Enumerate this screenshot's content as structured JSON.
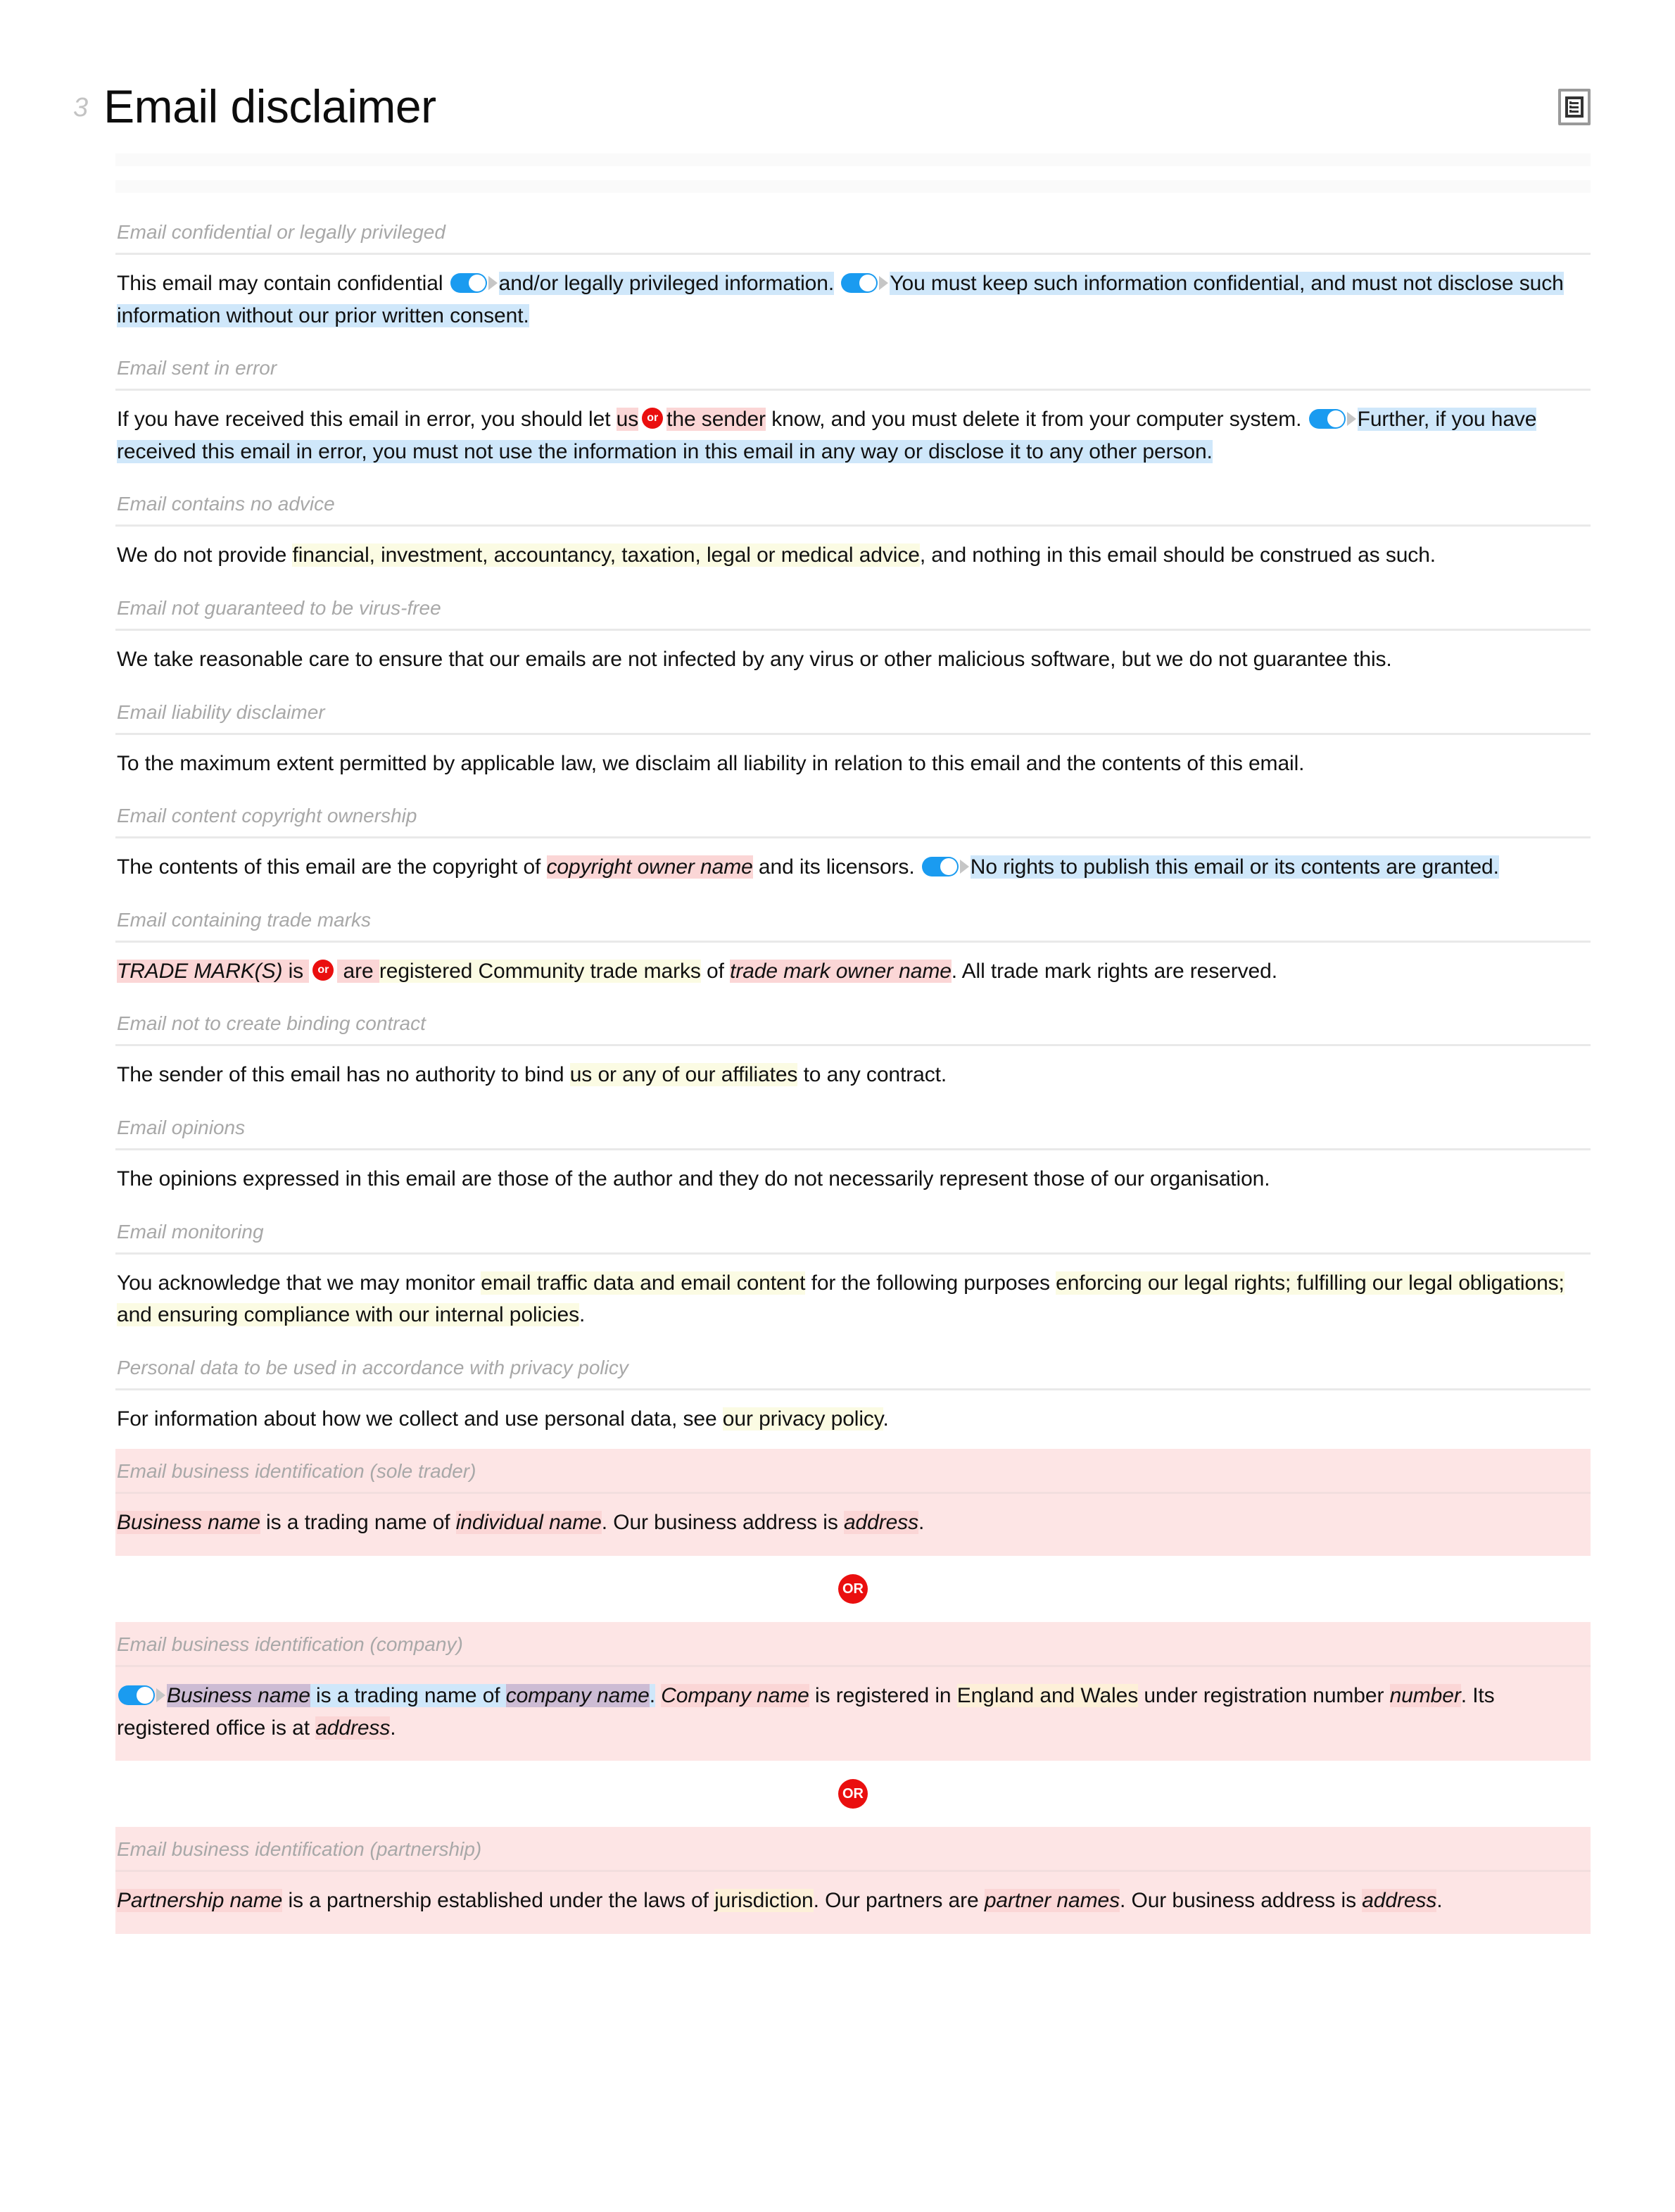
{
  "header": {
    "number": "3",
    "title": "Email disclaimer",
    "icon": "document-list-icon"
  },
  "colors": {
    "toggle_on": "#1a9bf0",
    "optional_highlight": "#cfe7fa",
    "variable_highlight": "#fbd6d6",
    "option_list_highlight": "#fbfbe3",
    "alt_block_background": "#fde5e5",
    "or_badge": "#ea0f0f",
    "heading_text": "#a8a8a8"
  },
  "badges": {
    "or_small": "or",
    "or_large": "OR"
  },
  "sections": [
    {
      "id": "confidential",
      "heading": "Email confidential or legally privileged",
      "text_parts": [
        {
          "t": "This email may contain confidential ",
          "s": "plain"
        },
        {
          "t": "toggle",
          "s": "toggle"
        },
        {
          "t": "and/or legally privileged information.",
          "s": "opt"
        },
        {
          "t": " ",
          "s": "plain"
        },
        {
          "t": "toggle",
          "s": "toggle"
        },
        {
          "t": "You must keep such information confidential, and must not disclose such information without our prior written consent.",
          "s": "opt"
        }
      ]
    },
    {
      "id": "sent-in-error",
      "heading": "Email sent in error",
      "text_parts": [
        {
          "t": "If you have received this email in error, you should let ",
          "s": "plain"
        },
        {
          "t": "us",
          "s": "var"
        },
        {
          "t": "or",
          "s": "or-badge"
        },
        {
          "t": "the sender",
          "s": "var"
        },
        {
          "t": " know, and you must delete it from your computer system. ",
          "s": "plain"
        },
        {
          "t": "toggle",
          "s": "toggle"
        },
        {
          "t": "Further, if you have received this email in error, you must not use the information in this email in any way or disclose it to any other person.",
          "s": "opt"
        }
      ]
    },
    {
      "id": "no-advice",
      "heading": "Email contains no advice",
      "text_parts": [
        {
          "t": "We do not provide ",
          "s": "plain"
        },
        {
          "t": "financial, investment, accountancy, taxation, legal or medical advice",
          "s": "list"
        },
        {
          "t": ", and nothing in this email should be construed as such.",
          "s": "plain"
        }
      ]
    },
    {
      "id": "virus-free",
      "heading": "Email not guaranteed to be virus-free",
      "text_parts": [
        {
          "t": "We take reasonable care to ensure that our emails are not infected by any virus or other malicious software, but we do not guarantee this.",
          "s": "plain"
        }
      ]
    },
    {
      "id": "liability",
      "heading": "Email liability disclaimer",
      "text_parts": [
        {
          "t": "To the maximum extent permitted by applicable law, we disclaim all liability in relation to this email and the contents of this email.",
          "s": "plain"
        }
      ]
    },
    {
      "id": "copyright",
      "heading": "Email content copyright ownership",
      "text_parts": [
        {
          "t": "The contents of this email are the copyright of ",
          "s": "plain"
        },
        {
          "t": "copyright owner name",
          "s": "var-ital"
        },
        {
          "t": " and its licensors. ",
          "s": "plain"
        },
        {
          "t": "toggle",
          "s": "toggle"
        },
        {
          "t": "No rights to publish this email or its contents are granted.",
          "s": "opt"
        }
      ]
    },
    {
      "id": "trade-marks",
      "heading": "Email containing trade marks",
      "text_parts": [
        {
          "t": "TRADE MARK(S)",
          "s": "var-ital"
        },
        {
          "t": " is ",
          "s": "var"
        },
        {
          "t": "or",
          "s": "or-badge"
        },
        {
          "t": " are ",
          "s": "var"
        },
        {
          "t": "registered Community trade marks",
          "s": "list"
        },
        {
          "t": " of ",
          "s": "plain"
        },
        {
          "t": "trade mark owner name",
          "s": "var-ital"
        },
        {
          "t": ". All trade mark rights are reserved.",
          "s": "plain"
        }
      ]
    },
    {
      "id": "binding-contract",
      "heading": "Email not to create binding contract",
      "text_parts": [
        {
          "t": "The sender of this email has no authority to bind ",
          "s": "plain"
        },
        {
          "t": "us or any of our affiliates",
          "s": "list"
        },
        {
          "t": " to any contract.",
          "s": "plain"
        }
      ]
    },
    {
      "id": "opinions",
      "heading": "Email opinions",
      "text_parts": [
        {
          "t": "The opinions expressed in this email are those of the author and they do not necessarily represent those of our organisation.",
          "s": "plain"
        }
      ]
    },
    {
      "id": "monitoring",
      "heading": "Email monitoring",
      "text_parts": [
        {
          "t": "You acknowledge that we may monitor ",
          "s": "plain"
        },
        {
          "t": "email traffic data and email content",
          "s": "list"
        },
        {
          "t": " for the following purposes ",
          "s": "plain"
        },
        {
          "t": "enforcing our legal rights; fulfilling our legal obligations; and ensuring compliance with our internal policies",
          "s": "list"
        },
        {
          "t": ".",
          "s": "plain"
        }
      ]
    },
    {
      "id": "privacy-policy",
      "heading": "Personal data to be used in accordance with privacy policy",
      "text_parts": [
        {
          "t": "For information about how we collect and use personal data, see ",
          "s": "plain"
        },
        {
          "t": "our privacy policy",
          "s": "list"
        },
        {
          "t": ".",
          "s": "plain"
        }
      ]
    }
  ],
  "alternatives": [
    {
      "id": "sole-trader",
      "heading": "Email business identification (sole trader)",
      "text_parts": [
        {
          "t": "Business name",
          "s": "var-ital"
        },
        {
          "t": " is a trading name of ",
          "s": "plain"
        },
        {
          "t": "individual name",
          "s": "var-ital"
        },
        {
          "t": ". Our business address is ",
          "s": "plain"
        },
        {
          "t": "address",
          "s": "var-ital"
        },
        {
          "t": ".",
          "s": "plain"
        }
      ]
    },
    {
      "id": "company",
      "heading": "Email business identification (company)",
      "text_parts": [
        {
          "t": "toggle",
          "s": "toggle"
        },
        {
          "t": "Business name",
          "s": "blend-ital"
        },
        {
          "t": " is a trading name of ",
          "s": "opt"
        },
        {
          "t": "company name",
          "s": "blend-ital"
        },
        {
          "t": ".",
          "s": "opt"
        },
        {
          "t": " ",
          "s": "plain"
        },
        {
          "t": "Company name",
          "s": "var-ital"
        },
        {
          "t": " is registered in ",
          "s": "plain"
        },
        {
          "t": "England and Wales",
          "s": "list2"
        },
        {
          "t": " under registration number ",
          "s": "plain"
        },
        {
          "t": "number",
          "s": "var-ital"
        },
        {
          "t": ". Its registered office is at ",
          "s": "plain"
        },
        {
          "t": "address",
          "s": "var-ital"
        },
        {
          "t": ".",
          "s": "plain"
        }
      ]
    },
    {
      "id": "partnership",
      "heading": "Email business identification (partnership)",
      "text_parts": [
        {
          "t": "Partnership name",
          "s": "var-ital"
        },
        {
          "t": " is a partnership established under the laws of ",
          "s": "plain"
        },
        {
          "t": "jurisdiction",
          "s": "list2"
        },
        {
          "t": ". Our partners are ",
          "s": "plain"
        },
        {
          "t": "partner names",
          "s": "var-ital"
        },
        {
          "t": ". Our business address is ",
          "s": "plain"
        },
        {
          "t": "address",
          "s": "var-ital"
        },
        {
          "t": ".",
          "s": "plain"
        }
      ]
    }
  ]
}
